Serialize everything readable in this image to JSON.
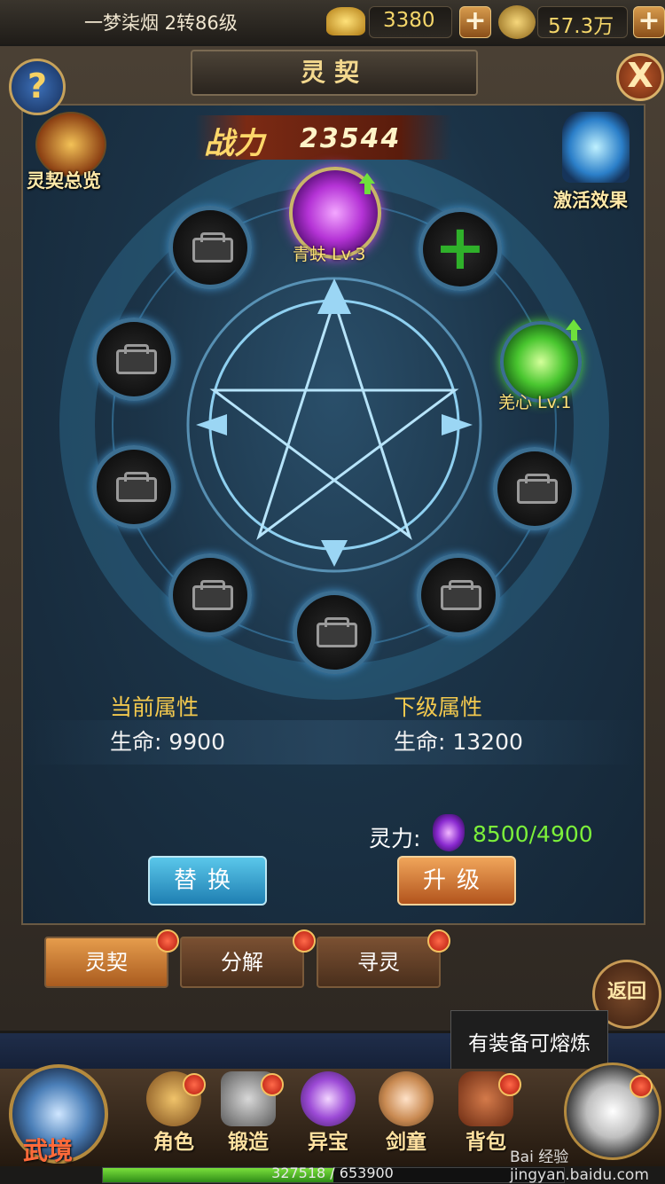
{
  "status_bar": {
    "player_info": "一梦柒烟   2转86级",
    "gold": "3380",
    "coins": "57.3万",
    "plus_label": "+"
  },
  "panel": {
    "title": "灵契",
    "help_label": "?",
    "close_label": "X"
  },
  "combat_power": {
    "label": "战力",
    "value": "23544"
  },
  "shortcuts": {
    "overview_label": "灵契总览",
    "activate_label": "激活效果"
  },
  "spirits": [
    {
      "name": "青蚨 Lv.3",
      "color": "#c44ee6",
      "upgrade": true
    },
    {
      "name": "羌心 Lv.1",
      "color": "#4ccf3a",
      "upgrade": true
    }
  ],
  "add_slot_label": "+",
  "stats": {
    "current_heading": "当前属性",
    "current_line": "生命: 9900",
    "next_heading": "下级属性",
    "next_line": "生命: 13200"
  },
  "spirit_power": {
    "label": "灵力:",
    "value": "8500/4900"
  },
  "actions": {
    "replace": "替换",
    "upgrade": "升级"
  },
  "tabs": [
    {
      "label": "灵契",
      "active": true
    },
    {
      "label": "分解",
      "active": false
    },
    {
      "label": "寻灵",
      "active": false
    }
  ],
  "back_label": "返回",
  "tooltip": "有装备可熔炼",
  "bottom_nav": {
    "home_label": "武境",
    "items": [
      "角色",
      "锻造",
      "异宝",
      "剑童",
      "背包"
    ]
  },
  "experience": {
    "text": "327518 / 653900",
    "fraction": 0.5009
  },
  "watermark": "Bai 经验 jingyan.baidu.com"
}
